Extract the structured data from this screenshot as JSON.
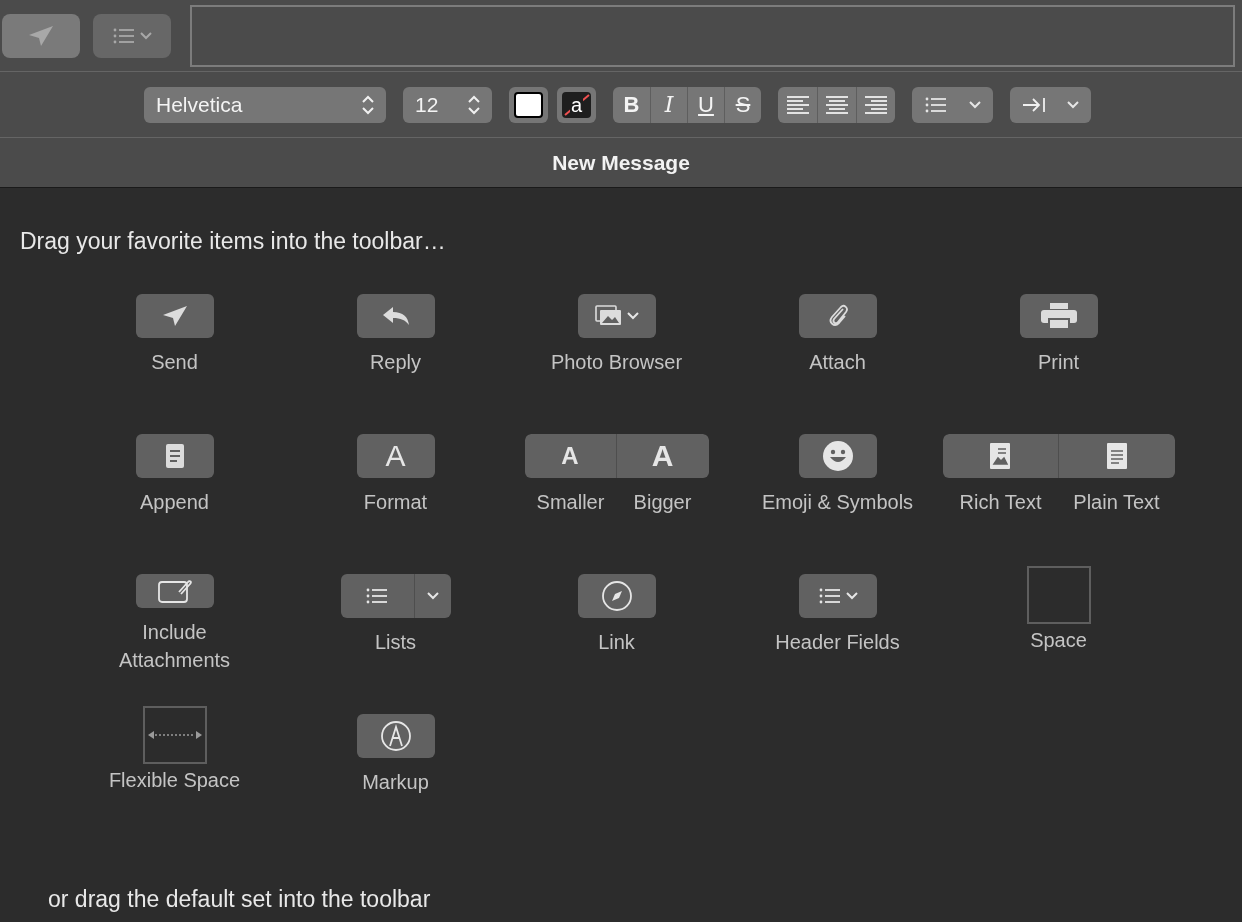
{
  "toolbar": {
    "buttons": [
      {
        "kind": "send"
      },
      {
        "kind": "header-fields"
      }
    ]
  },
  "format_bar": {
    "font": "Helvetica",
    "size": "12",
    "background_color_glyph": "a",
    "styles": [
      {
        "kind": "bold",
        "glyph": "B"
      },
      {
        "kind": "italic",
        "glyph": "I"
      },
      {
        "kind": "underline",
        "glyph": "U"
      },
      {
        "kind": "strike",
        "glyph": "S"
      }
    ]
  },
  "window": {
    "title": "New Message"
  },
  "palette": {
    "prompt": "Drag your favorite items into the toolbar…",
    "items": [
      {
        "kind": "single",
        "label": "Send"
      },
      {
        "kind": "single",
        "label": "Reply"
      },
      {
        "kind": "single",
        "label": "Photo Browser"
      },
      {
        "kind": "single",
        "label": "Attach"
      },
      {
        "kind": "single",
        "label": "Print"
      },
      {
        "kind": "single",
        "label": "Append"
      },
      {
        "kind": "single",
        "label": "Format",
        "glyph": "A"
      },
      {
        "kind": "pair",
        "parts": [
          {
            "label": "Smaller",
            "glyph": "A"
          },
          {
            "label": "Bigger",
            "glyph": "A"
          }
        ]
      },
      {
        "kind": "single",
        "label": "Emoji & Symbols"
      },
      {
        "kind": "pair",
        "parts": [
          {
            "label": "Rich Text"
          },
          {
            "label": "Plain Text"
          }
        ]
      },
      {
        "kind": "single",
        "label": "Include Attachments"
      },
      {
        "kind": "split",
        "label": "Lists"
      },
      {
        "kind": "single",
        "label": "Link"
      },
      {
        "kind": "single",
        "label": "Header Fields"
      },
      {
        "kind": "space",
        "label": "Space"
      },
      {
        "kind": "flexspace",
        "label": "Flexible Space"
      },
      {
        "kind": "single",
        "label": "Markup"
      }
    ],
    "footer": "or drag the default set into the toolbar"
  }
}
